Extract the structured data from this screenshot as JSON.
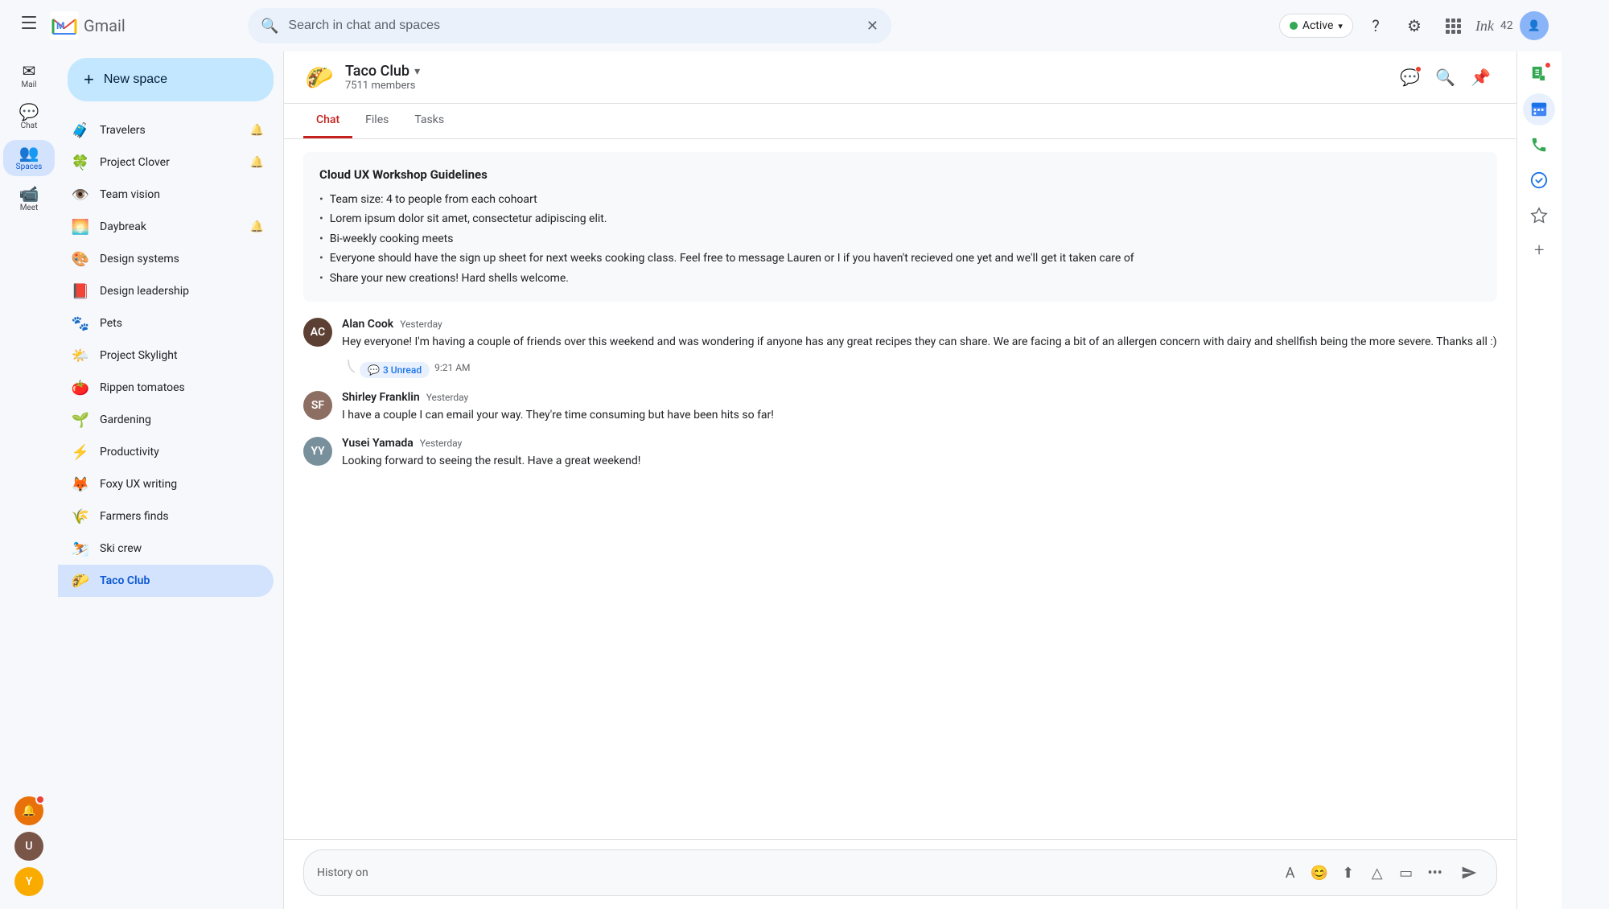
{
  "topbar": {
    "search_placeholder": "Search in chat and spaces",
    "status_label": "Active",
    "status_color": "#34a853",
    "help_icon": "?",
    "settings_icon": "⚙",
    "apps_icon": "⋮⋮⋮",
    "ink_label": "Ink",
    "ink_number": "42"
  },
  "sidebar": {
    "new_space_label": "New space",
    "items": [
      {
        "id": "travelers",
        "emoji": "🧳",
        "name": "Travelers",
        "bell": true
      },
      {
        "id": "project-clover",
        "emoji": "🍀",
        "name": "Project Clover",
        "bell": true
      },
      {
        "id": "team-vision",
        "emoji": "👁️",
        "name": "Team vision",
        "bell": false
      },
      {
        "id": "daybreak",
        "emoji": "🌅",
        "name": "Daybreak",
        "bell": true
      },
      {
        "id": "design-systems",
        "emoji": "🎨",
        "name": "Design systems",
        "bell": false
      },
      {
        "id": "design-leadership",
        "emoji": "📕",
        "name": "Design leadership",
        "bell": false
      },
      {
        "id": "pets",
        "emoji": "🐾",
        "name": "Pets",
        "bell": false
      },
      {
        "id": "project-skylight",
        "emoji": "🌤️",
        "name": "Project Skylight",
        "bell": false
      },
      {
        "id": "rippen-tomatoes",
        "emoji": "🍅",
        "name": "Rippen tomatoes",
        "bell": false
      },
      {
        "id": "gardening",
        "emoji": "🌱",
        "name": "Gardening",
        "bell": false
      },
      {
        "id": "productivity",
        "emoji": "⚡",
        "name": "Productivity",
        "bell": false
      },
      {
        "id": "foxy-ux-writing",
        "emoji": "🦊",
        "name": "Foxy UX writing",
        "bell": false
      },
      {
        "id": "farmers-finds",
        "emoji": "🌾",
        "name": "Farmers finds",
        "bell": false
      },
      {
        "id": "ski-crew",
        "emoji": "⛷️",
        "name": "Ski crew",
        "bell": false
      },
      {
        "id": "taco-club",
        "emoji": "🌮",
        "name": "Taco Club",
        "bell": false,
        "active": true
      }
    ]
  },
  "left_rail": [
    {
      "id": "mail",
      "icon": "✉",
      "label": "Mail"
    },
    {
      "id": "chat",
      "icon": "💬",
      "label": "Chat"
    },
    {
      "id": "spaces",
      "icon": "👥",
      "label": "Spaces",
      "active": true
    },
    {
      "id": "meet",
      "icon": "📹",
      "label": "Meet"
    }
  ],
  "chat_area": {
    "space_name": "Taco Club",
    "space_members": "7511 members",
    "tabs": [
      "Chat",
      "Files",
      "Tasks"
    ],
    "active_tab": "Chat",
    "guidelines": {
      "title": "Cloud UX Workshop Guidelines",
      "items": [
        "Team size: 4 to people from each cohoart",
        "Lorem ipsum dolor sit amet, consectetur adipiscing elit.",
        "Bi-weekly cooking meets",
        "Everyone should have the sign up sheet for next weeks cooking class. Feel free to message Lauren or I if you haven't recieved one yet and we'll get it taken care of",
        "Share your new creations! Hard shells welcome."
      ]
    },
    "messages": [
      {
        "id": "alan-cook",
        "name": "Alan Cook",
        "time": "Yesterday",
        "text": "Hey everyone! I'm having a couple of friends over this weekend and was wondering if anyone has any great recipes they can share. We are facing a bit of an allergen concern with dairy and shellfish being the more severe. Thanks all :)",
        "unread_count": "3 Unread",
        "unread_time": "9:21 AM",
        "avatar_bg": "#5c4033",
        "avatar_initials": "AC"
      },
      {
        "id": "shirley-franklin",
        "name": "Shirley Franklin",
        "time": "Yesterday",
        "text": "I have a couple I can email your way. They're time consuming but have been hits so far!",
        "avatar_bg": "#8d6e63",
        "avatar_initials": "SF"
      },
      {
        "id": "yusei-yamada",
        "name": "Yusei Yamada",
        "time": "Yesterday",
        "text": "Looking forward to seeing the result. Have a great weekend!",
        "avatar_bg": "#78909c",
        "avatar_initials": "YY"
      }
    ],
    "input_placeholder": "History on"
  },
  "right_panel": {
    "icons": [
      {
        "id": "sheets",
        "label": "Google Sheets",
        "color": "green"
      },
      {
        "id": "calendar",
        "label": "Google Calendar",
        "color": "blue"
      },
      {
        "id": "phone",
        "label": "Phone",
        "color": "green"
      },
      {
        "id": "tasks",
        "label": "Tasks",
        "color": "blue"
      },
      {
        "id": "star",
        "label": "Starred",
        "color": "default"
      },
      {
        "id": "add",
        "label": "Add app",
        "color": "default"
      }
    ]
  },
  "icons": {
    "search": "🔍",
    "bell": "🔔",
    "send": "➤",
    "format": "A",
    "emoji": "😊",
    "upload": "⬆",
    "drive": "△",
    "video": "□",
    "more": "•••"
  }
}
